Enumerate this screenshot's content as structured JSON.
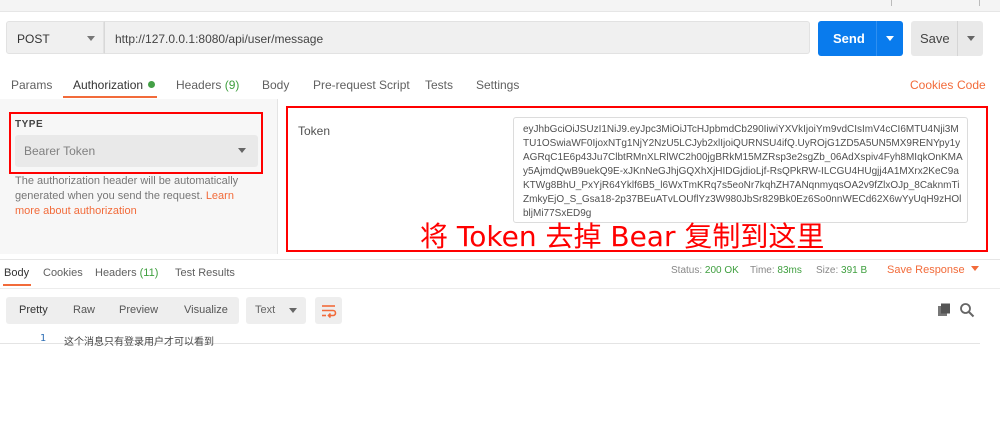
{
  "request": {
    "method": "POST",
    "url": "http://127.0.0.1:8080/api/user/message",
    "send_label": "Send",
    "save_label": "Save"
  },
  "request_tabs": [
    {
      "label": "Params"
    },
    {
      "label": "Authorization"
    },
    {
      "label": "Headers",
      "count": "(9)"
    },
    {
      "label": "Body"
    },
    {
      "label": "Pre-request Script"
    },
    {
      "label": "Tests"
    },
    {
      "label": "Settings"
    }
  ],
  "links": {
    "cookies": "Cookies",
    "code": "Code"
  },
  "auth": {
    "type_label": "TYPE",
    "type_value": "Bearer Token",
    "help_text": "The authorization header will be automatically generated when you send the request.",
    "help_link": "Learn more about authorization",
    "token_label": "Token",
    "token_value": "eyJhbGciOiJSUzI1NiJ9.eyJpc3MiOiJTcHJpbmdCb290IiwiYXVkIjoiYm9vdCIsImV4cCI6MTU4Nji3MTU1OSwiaWF0IjoxNTg1NjY2NzU5LCJyb2xlIjoiQURNSU4ifQ.UyROjG1ZD5A5UN5MX9RENYpy1yAGRqC1E6p43Ju7ClbtRMnXLRlWC2h00jgBRkM15MZRsp3e2sgZb_06AdXspiv4Fyh8MIqkOnKMAy5AjmdQwB9uekQ9E-xJKnNeGJhjGQXhXjHIDGjdioLjf-RsQPkRW-ILCGU4HUgjj4A1MXrx2KeC9aKTWg8BhU_PxYjR64Yklf6B5_l6WxTmKRq7s5eoNr7kqhZH7ANqnmyqsOA2v9fZlxOJp_8CaknmTiZmkyEjO_S_Gsa18-2p37BEuATvLOUflYz3W980JbSr829Bk0Ez6So0nnWECd62X6wYyUqH9zHOlbljMi77SxED9g",
    "annotation": "将 Token 去掉 Bear 复制到这里"
  },
  "response": {
    "tabs": [
      {
        "label": "Body"
      },
      {
        "label": "Cookies"
      },
      {
        "label": "Headers",
        "count": "(11)"
      },
      {
        "label": "Test Results"
      }
    ],
    "status_label": "Status:",
    "status_value": "200 OK",
    "time_label": "Time:",
    "time_value": "83ms",
    "size_label": "Size:",
    "size_value": "391 B",
    "save_response": "Save Response",
    "view_modes": [
      "Pretty",
      "Raw",
      "Preview",
      "Visualize"
    ],
    "format": "Text",
    "line_number": "1",
    "body_text": "这个消息只有登录用户才可以看到"
  },
  "colors": {
    "accent": "#f26b3a",
    "send_button": "#097bed",
    "status_ok": "#3f9f3f",
    "annotation": "#ff0000"
  },
  "icons": [
    "chevron-down-icon",
    "wrap-lines-icon",
    "copy-icon",
    "search-icon"
  ]
}
